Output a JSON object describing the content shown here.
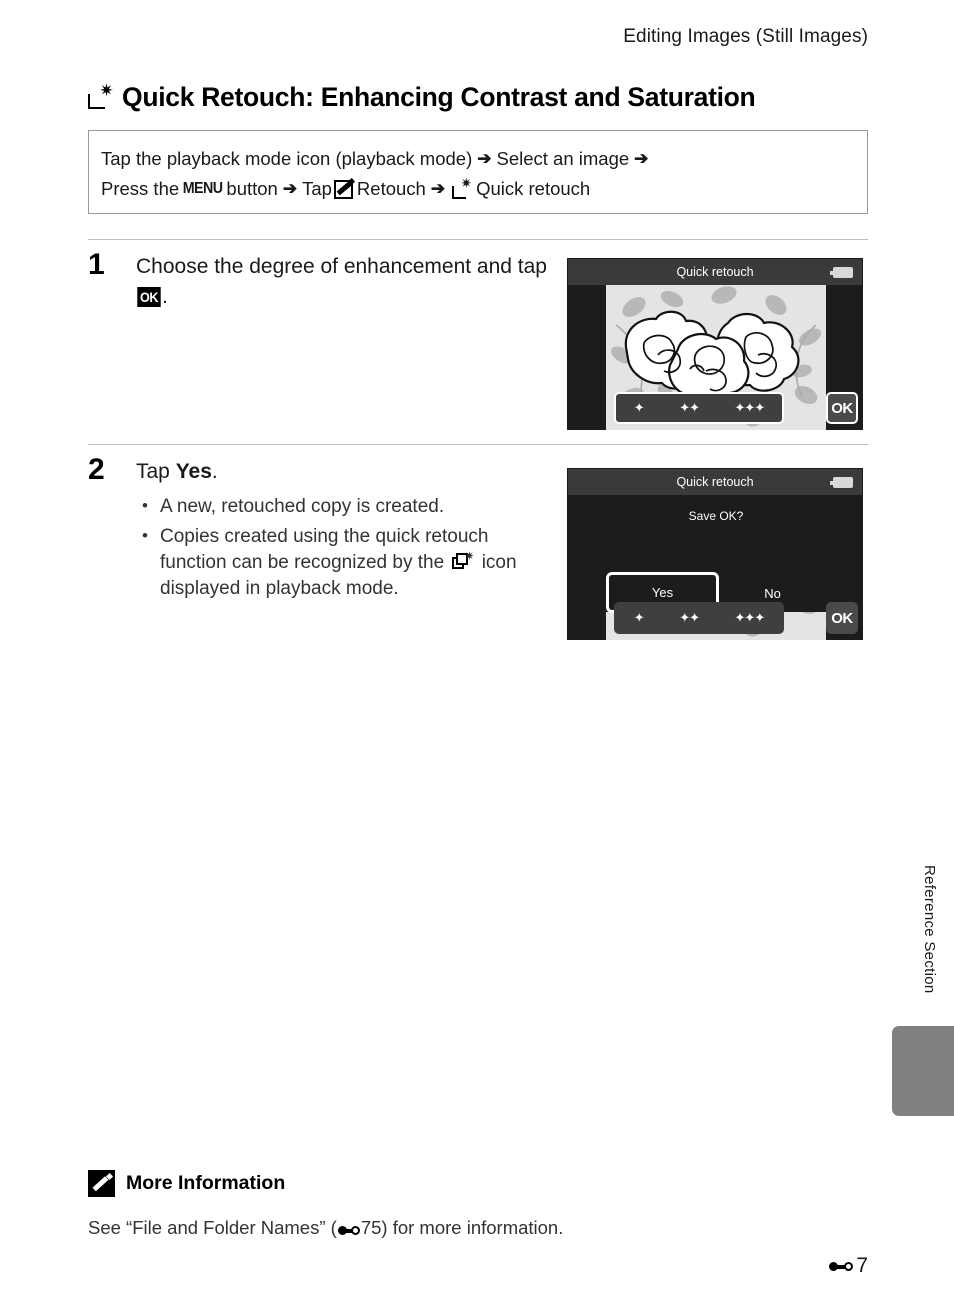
{
  "header": {
    "running_head": "Editing Images (Still Images)"
  },
  "title": {
    "icon": "quick-retouch-icon",
    "text": "Quick Retouch: Enhancing Contrast and Saturation"
  },
  "instruction_box": {
    "line1_part1": "Tap the playback mode icon (playback mode)",
    "line1_arrow": "➔",
    "line1_part2": "Select an image",
    "line1_arrow2": "➔",
    "line2_part1": "Press the",
    "menu_label": "MENU",
    "line2_part2": "button",
    "line2_arrow": "➔",
    "line2_tap": "Tap",
    "retouch_icon": "retouch-pencil-icon",
    "line2_retouch": "Retouch",
    "line2_arrow2": "➔",
    "quick_retouch_icon": "quick-retouch-icon",
    "line2_quick": "Quick retouch"
  },
  "steps": [
    {
      "number": "1",
      "head_before": "Choose the degree of enhancement and tap ",
      "ok_label": "OK",
      "head_after": ".",
      "bullets": []
    },
    {
      "number": "2",
      "head_before": "Tap ",
      "head_bold": "Yes",
      "head_after": ".",
      "bullets": [
        {
          "text": "A new, retouched copy is created."
        },
        {
          "text_before": "Copies created using the quick retouch function can be recognized by the",
          "icon": "retouched-copy-icon",
          "text_after": "icon displayed in playback mode."
        }
      ]
    }
  ],
  "screens": [
    {
      "title": "Quick retouch",
      "battery_icon": "battery-icon",
      "levels": [
        "✦",
        "✦✦",
        "✦✦✦"
      ],
      "ok_button": "OK",
      "dialog": null
    },
    {
      "title": "Quick retouch",
      "battery_icon": "battery-icon",
      "levels": [
        "✦",
        "✦✦",
        "✦✦✦"
      ],
      "ok_button": "OK",
      "dialog": {
        "question": "Save OK?",
        "yes_label": "Yes",
        "no_label": "No",
        "selected": "Yes"
      }
    }
  ],
  "side_tab": {
    "label": "Reference Section"
  },
  "more_information": {
    "icon": "note-pencil-icon",
    "title": "More Information",
    "text_before": "See “File and Folder Names” (",
    "ref_icon": "binoculars-e-icon",
    "ref_page": "75",
    "text_after": ") for more information."
  },
  "footer": {
    "ref_icon": "binoculars-e-icon",
    "page": "7"
  },
  "colors": {
    "box_border": "#9a9a9a",
    "rule": "#bfbfbf",
    "screen_bg": "#1c1c1c",
    "screen_bar": "#3a3a3a",
    "side_tab": "#808080"
  }
}
